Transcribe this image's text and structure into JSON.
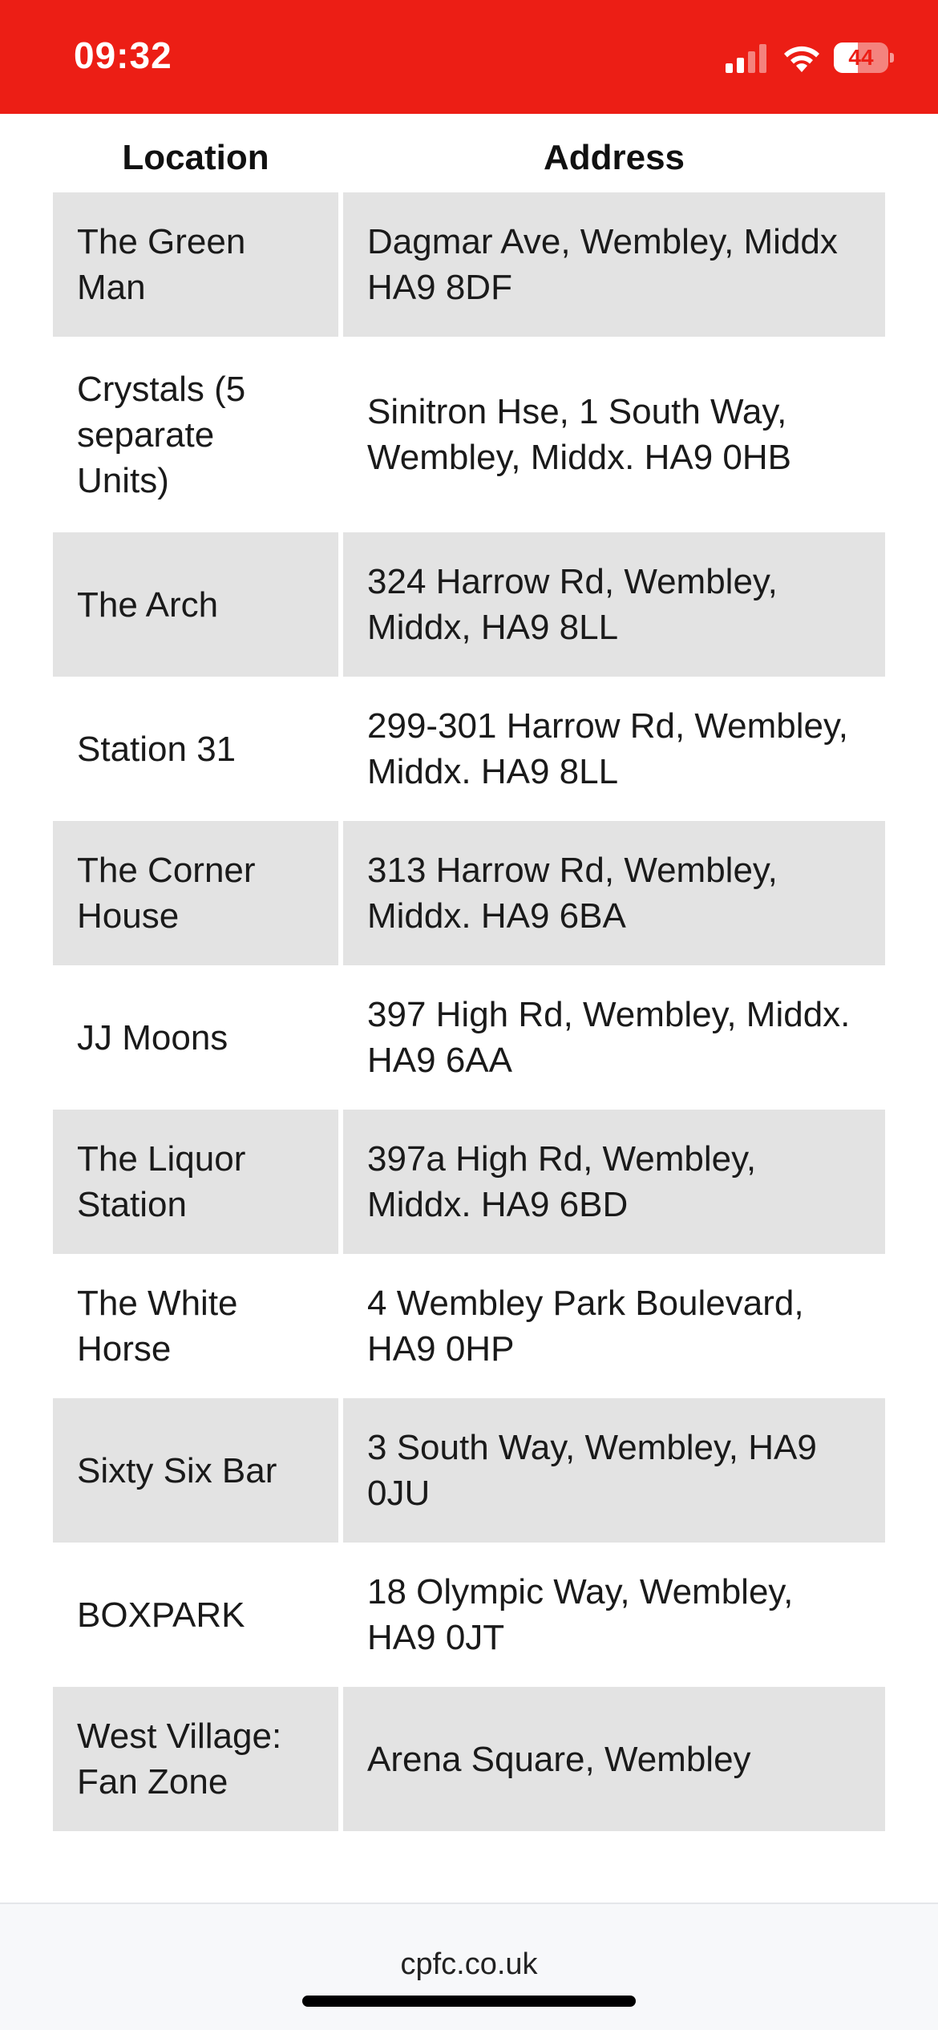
{
  "status_bar": {
    "time": "09:32",
    "battery_level": "44",
    "signal_bars_active": 2,
    "signal_bars_total": 4,
    "background_color": "#ec1e15"
  },
  "table": {
    "headers": [
      "Location",
      "Address"
    ],
    "rows": [
      {
        "location": "The Green Man",
        "address": "Dagmar Ave, Wembley, Middx HA9 8DF"
      },
      {
        "location": "Crystals (5 separate Units)",
        "address": "Sinitron Hse, 1 South Way, Wembley, Middx. HA9 0HB"
      },
      {
        "location": "The Arch",
        "address": "324 Harrow Rd, Wembley, Middx, HA9 8LL"
      },
      {
        "location": "Station 31",
        "address": "299-301 Harrow Rd, Wembley, Middx. HA9 8LL"
      },
      {
        "location": "The Corner House",
        "address": "313 Harrow Rd, Wembley, Middx. HA9 6BA"
      },
      {
        "location": "JJ Moons",
        "address": "397 High Rd, Wembley, Middx. HA9 6AA"
      },
      {
        "location": "The Liquor Station",
        "address": "397a High Rd, Wembley, Middx. HA9 6BD"
      },
      {
        "location": "The White Horse",
        "address": "4 Wembley Park Boulevard, HA9 0HP"
      },
      {
        "location": "Sixty Six Bar",
        "address": "3 South Way, Wembley, HA9 0JU"
      },
      {
        "location": "BOXPARK",
        "address": "18 Olympic Way, Wembley, HA9 0JT"
      },
      {
        "location": "West Village: Fan Zone",
        "address": "Arena Square, Wembley"
      }
    ],
    "shaded_row_color": "#e3e3e3"
  },
  "footer": {
    "url": "cpfc.co.uk"
  }
}
